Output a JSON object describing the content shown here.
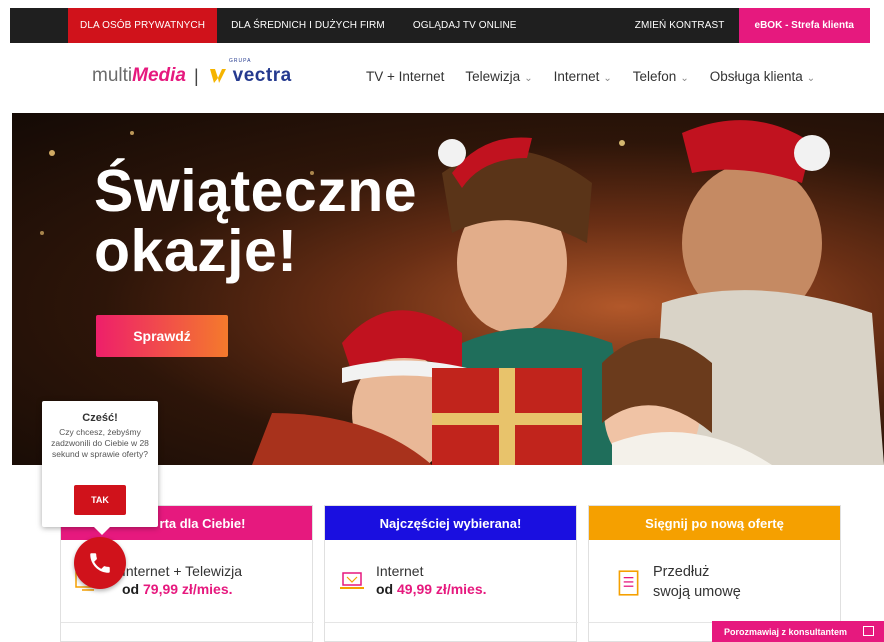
{
  "topbar": {
    "private": "DLA OSÓB PRYWATNYCH",
    "business": "DLA ŚREDNICH I DUŻYCH FIRM",
    "tv": "OGLĄDAJ TV ONLINE",
    "contrast": "ZMIEŃ KONTRAST",
    "ebok": "eBOK - Strefa klienta"
  },
  "logo": {
    "multi": "multi",
    "media": "Media",
    "sep": "|",
    "grupa": "GRUPA",
    "vectra": "vectra"
  },
  "menu": {
    "items": [
      {
        "label": "TV + Internet",
        "dropdown": false
      },
      {
        "label": "Telewizja",
        "dropdown": true
      },
      {
        "label": "Internet",
        "dropdown": true
      },
      {
        "label": "Telefon",
        "dropdown": true
      },
      {
        "label": "Obsługa klienta",
        "dropdown": true
      }
    ],
    "chevron": "⌄"
  },
  "hero": {
    "title_line1": "Świąteczne",
    "title_line2": "okazje!",
    "button": "Sprawdź"
  },
  "cards": [
    {
      "header": "Oferta dla Ciebie!",
      "header_visible": "rta dla Ciebie!",
      "color": "#e6197e",
      "line1": "Internet + Telewizja",
      "price_prefix": "od ",
      "price": "79,99 zł/mies."
    },
    {
      "header": "Najczęściej wybierana!",
      "color": "#1a0fe0",
      "line1": "Internet",
      "price_prefix": "od ",
      "price": "49,99 zł/mies."
    },
    {
      "header": "Sięgnij po nową ofertę",
      "color": "#f5a000",
      "line1": "Przedłuż",
      "line2": "swoją umowę"
    }
  ],
  "chat": {
    "title": "Cześć!",
    "text": "Czy chcesz, żebyśmy zadzwonili do Ciebie w 28 sekund w sprawie oferty?",
    "button": "TAK"
  },
  "consult": {
    "label": "Porozmawiaj z konsultantem"
  },
  "colors": {
    "pink": "#e6197e",
    "red": "#d0121b",
    "blue": "#1a0fe0",
    "orange": "#f5a000",
    "topbar": "#1f1f1f"
  }
}
